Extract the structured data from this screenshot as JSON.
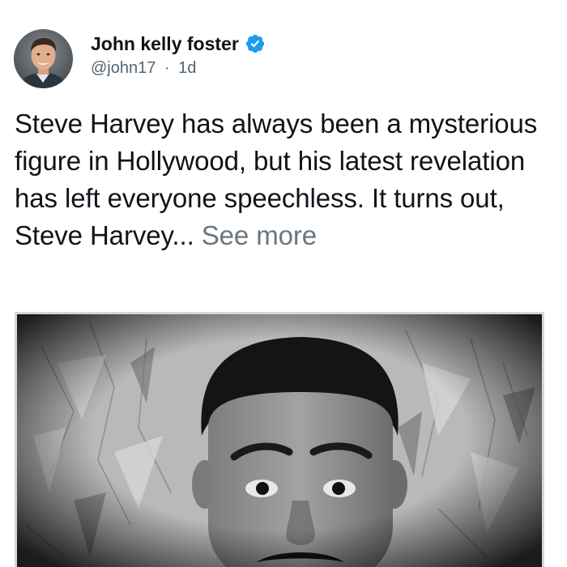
{
  "author": {
    "display_name": "John kelly foster",
    "handle": "@john17",
    "separator": "·",
    "timestamp": "1d",
    "verified_badge_icon": "verified-check-icon",
    "verified_color": "#1d9bf0"
  },
  "tweet": {
    "text": "Steve Harvey has always been a mysterious figure in Hollywood, but his latest revelation has left everyone speechless. It turns out, Steve Harvey...",
    "see_more_label": "See more"
  },
  "media": {
    "type": "photo",
    "style": "black-and-white portrait"
  },
  "colors": {
    "text_primary": "#0f1419",
    "text_secondary": "#536471",
    "see_more": "#6b7580",
    "media_border": "#cfd9de"
  }
}
